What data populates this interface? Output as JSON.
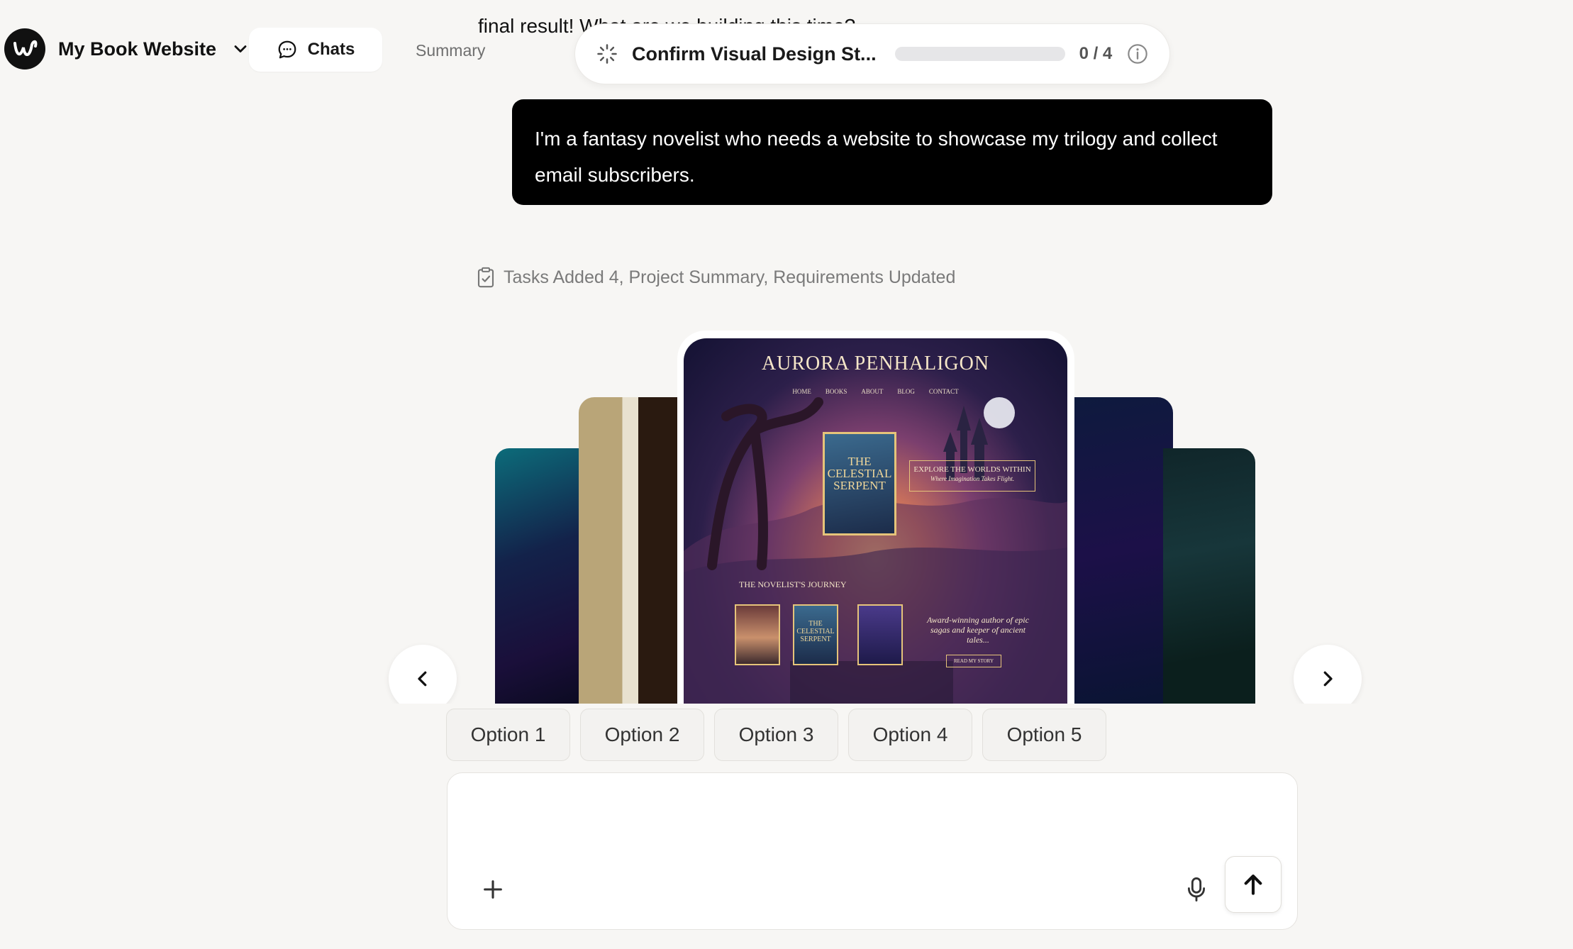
{
  "header": {
    "project_name": "My Book Website",
    "tabs": [
      {
        "label": "Chats",
        "active": true
      },
      {
        "label": "Summary",
        "active": false
      }
    ]
  },
  "chat": {
    "previous_message_fragment": "final result! What are we building this time?",
    "user_message": "I'm a fantasy novelist who needs a website to showcase my trilogy and collect email subscribers.",
    "tasks_status": "Tasks Added 4, Project Summary, Requirements Updated"
  },
  "progress": {
    "title": "Confirm Visual Design St...",
    "count": "0 / 4",
    "fraction": 0
  },
  "preview": {
    "site_title": "AURORA PENHALIGON",
    "nav": [
      "HOME",
      "BOOKS",
      "ABOUT",
      "BLOG",
      "CONTACT"
    ],
    "hero_book_title": "THE CELESTIAL SERPENT",
    "explore_title": "EXPLORE THE WORLDS WITHIN",
    "explore_subtitle": "Where Imagination Takes Flight.",
    "journey_heading": "THE NOVELIST'S JOURNEY",
    "thumb_serpent": "THE CELESTIAL SERPENT",
    "award_text": "Award-winning author of epic sagas and keeper of ancient tales...",
    "read_button": "READ MY STORY"
  },
  "options": [
    "Option 1",
    "Option 2",
    "Option 3",
    "Option 4",
    "Option 5"
  ],
  "composer": {
    "value": "",
    "placeholder": ""
  },
  "colors": {
    "background": "#f7f6f4",
    "user_bubble": "#000000",
    "accent_text": "#111111"
  },
  "icons": {
    "logo": "brand-w-logo",
    "dropdown": "chevron-down-icon",
    "chats": "chat-bubble-icon",
    "progress": "spinner-icon",
    "info": "info-icon",
    "tasks": "clipboard-check-icon",
    "prev": "chevron-left-icon",
    "next": "chevron-right-icon",
    "attach": "plus-icon",
    "mic": "microphone-icon",
    "send": "arrow-up-icon"
  }
}
